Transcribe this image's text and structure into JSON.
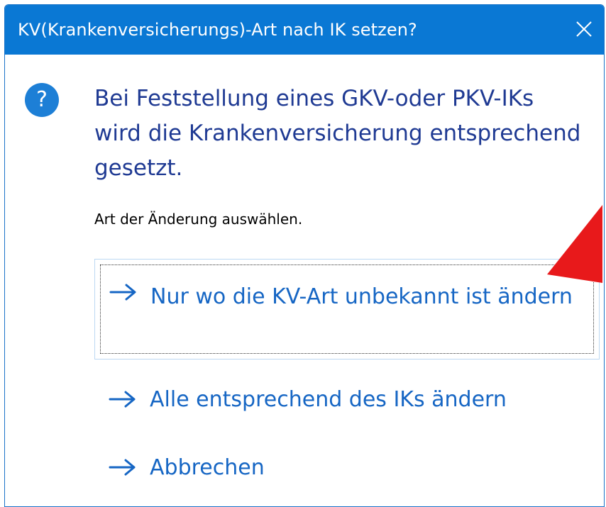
{
  "dialog": {
    "title": "KV(Krankenversicherungs)-Art nach IK setzen?",
    "close_icon": "close-icon",
    "icon": "question-icon",
    "icon_glyph": "?",
    "main_instruction": "Bei Feststellung eines GKV-oder PKV-IKs wird die Krankenversicherung entsprechend gesetzt.",
    "content": "Art der Änderung auswählen.",
    "commands": [
      {
        "label": "Nur wo die KV-Art unbekannt ist ändern",
        "icon": "arrow-right-icon"
      },
      {
        "label": "Alle entsprechend des IKs ändern",
        "icon": "arrow-right-icon"
      },
      {
        "label": "Abbrechen",
        "icon": "arrow-right-icon"
      }
    ]
  },
  "colors": {
    "titlebar": "#0a78d4",
    "main_text": "#1f3a93",
    "command_text": "#1666c4",
    "annotation_arrow": "#e8191b"
  }
}
